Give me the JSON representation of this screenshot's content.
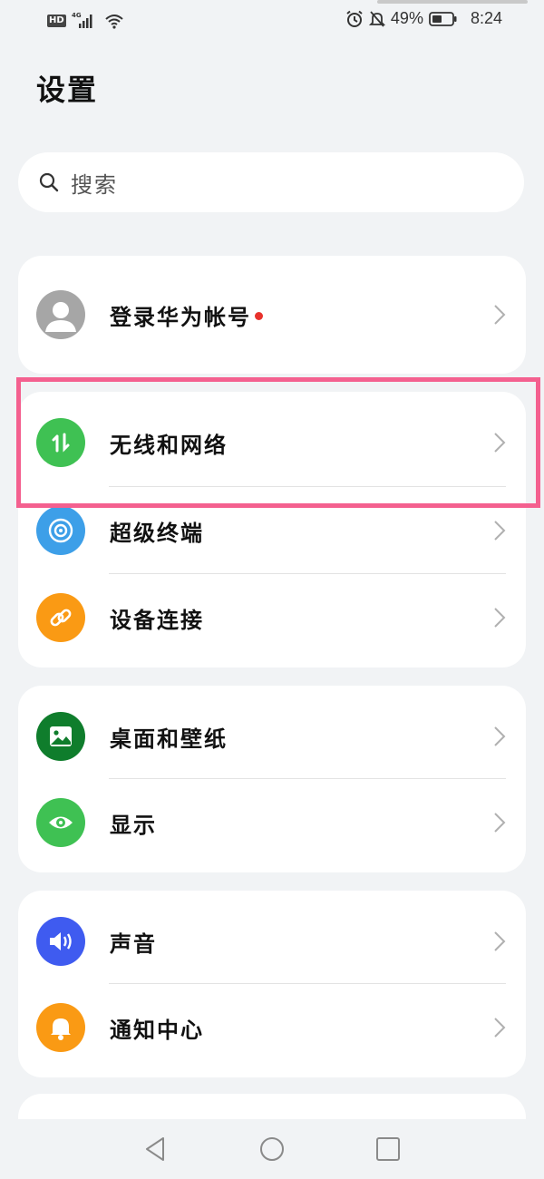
{
  "status_bar": {
    "left_badges": [
      "HD",
      "4G"
    ],
    "battery": "49%",
    "time": "8:24"
  },
  "page": {
    "title": "设置"
  },
  "search": {
    "placeholder": "搜索"
  },
  "account": {
    "label": "登录华为帐号",
    "has_notification_dot": true
  },
  "groups": [
    {
      "items": [
        {
          "label": "无线和网络",
          "icon": "wireless-network-icon",
          "color": "#3fc153",
          "highlighted": true
        },
        {
          "label": "超级终端",
          "icon": "super-device-icon",
          "color": "#3d9fe8"
        },
        {
          "label": "设备连接",
          "icon": "link-icon",
          "color": "#fa9a14"
        }
      ]
    },
    {
      "items": [
        {
          "label": "桌面和壁纸",
          "icon": "wallpaper-icon",
          "color": "#0f7d2c"
        },
        {
          "label": "显示",
          "icon": "eye-icon",
          "color": "#3fc153"
        }
      ]
    },
    {
      "items": [
        {
          "label": "声音",
          "icon": "speaker-icon",
          "color": "#3f5bf0"
        },
        {
          "label": "通知中心",
          "icon": "bell-icon",
          "color": "#fa9a14"
        }
      ]
    }
  ],
  "nav": [
    "back-icon",
    "home-icon",
    "recents-icon"
  ]
}
